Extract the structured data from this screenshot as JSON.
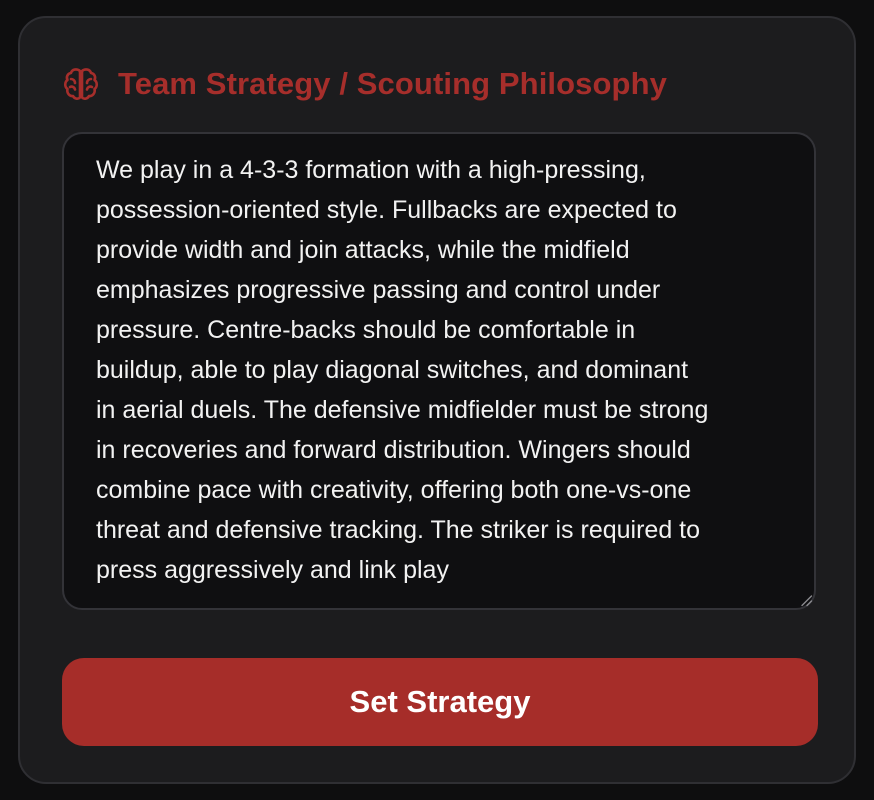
{
  "panel": {
    "title": "Team Strategy / Scouting Philosophy",
    "title_icon": "brain-icon",
    "accent_color": "#a62e2b"
  },
  "strategy": {
    "value": "We play in a 4-3-3 formation with a high-pressing,\npossession-oriented style. Fullbacks are expected to\nprovide width and join attacks, while the midfield\nemphasizes progressive passing and control under\npressure. Centre-backs should be comfortable in\nbuildup, able to play diagonal switches, and dominant\nin aerial duels. The defensive midfielder must be strong\nin recoveries and forward distribution. Wingers should\ncombine pace with creativity, offering both one-vs-one\nthreat and defensive tracking. The striker is required to\npress aggressively and link play"
  },
  "actions": {
    "set_label": "Set Strategy",
    "button_color": "#a62d29"
  }
}
